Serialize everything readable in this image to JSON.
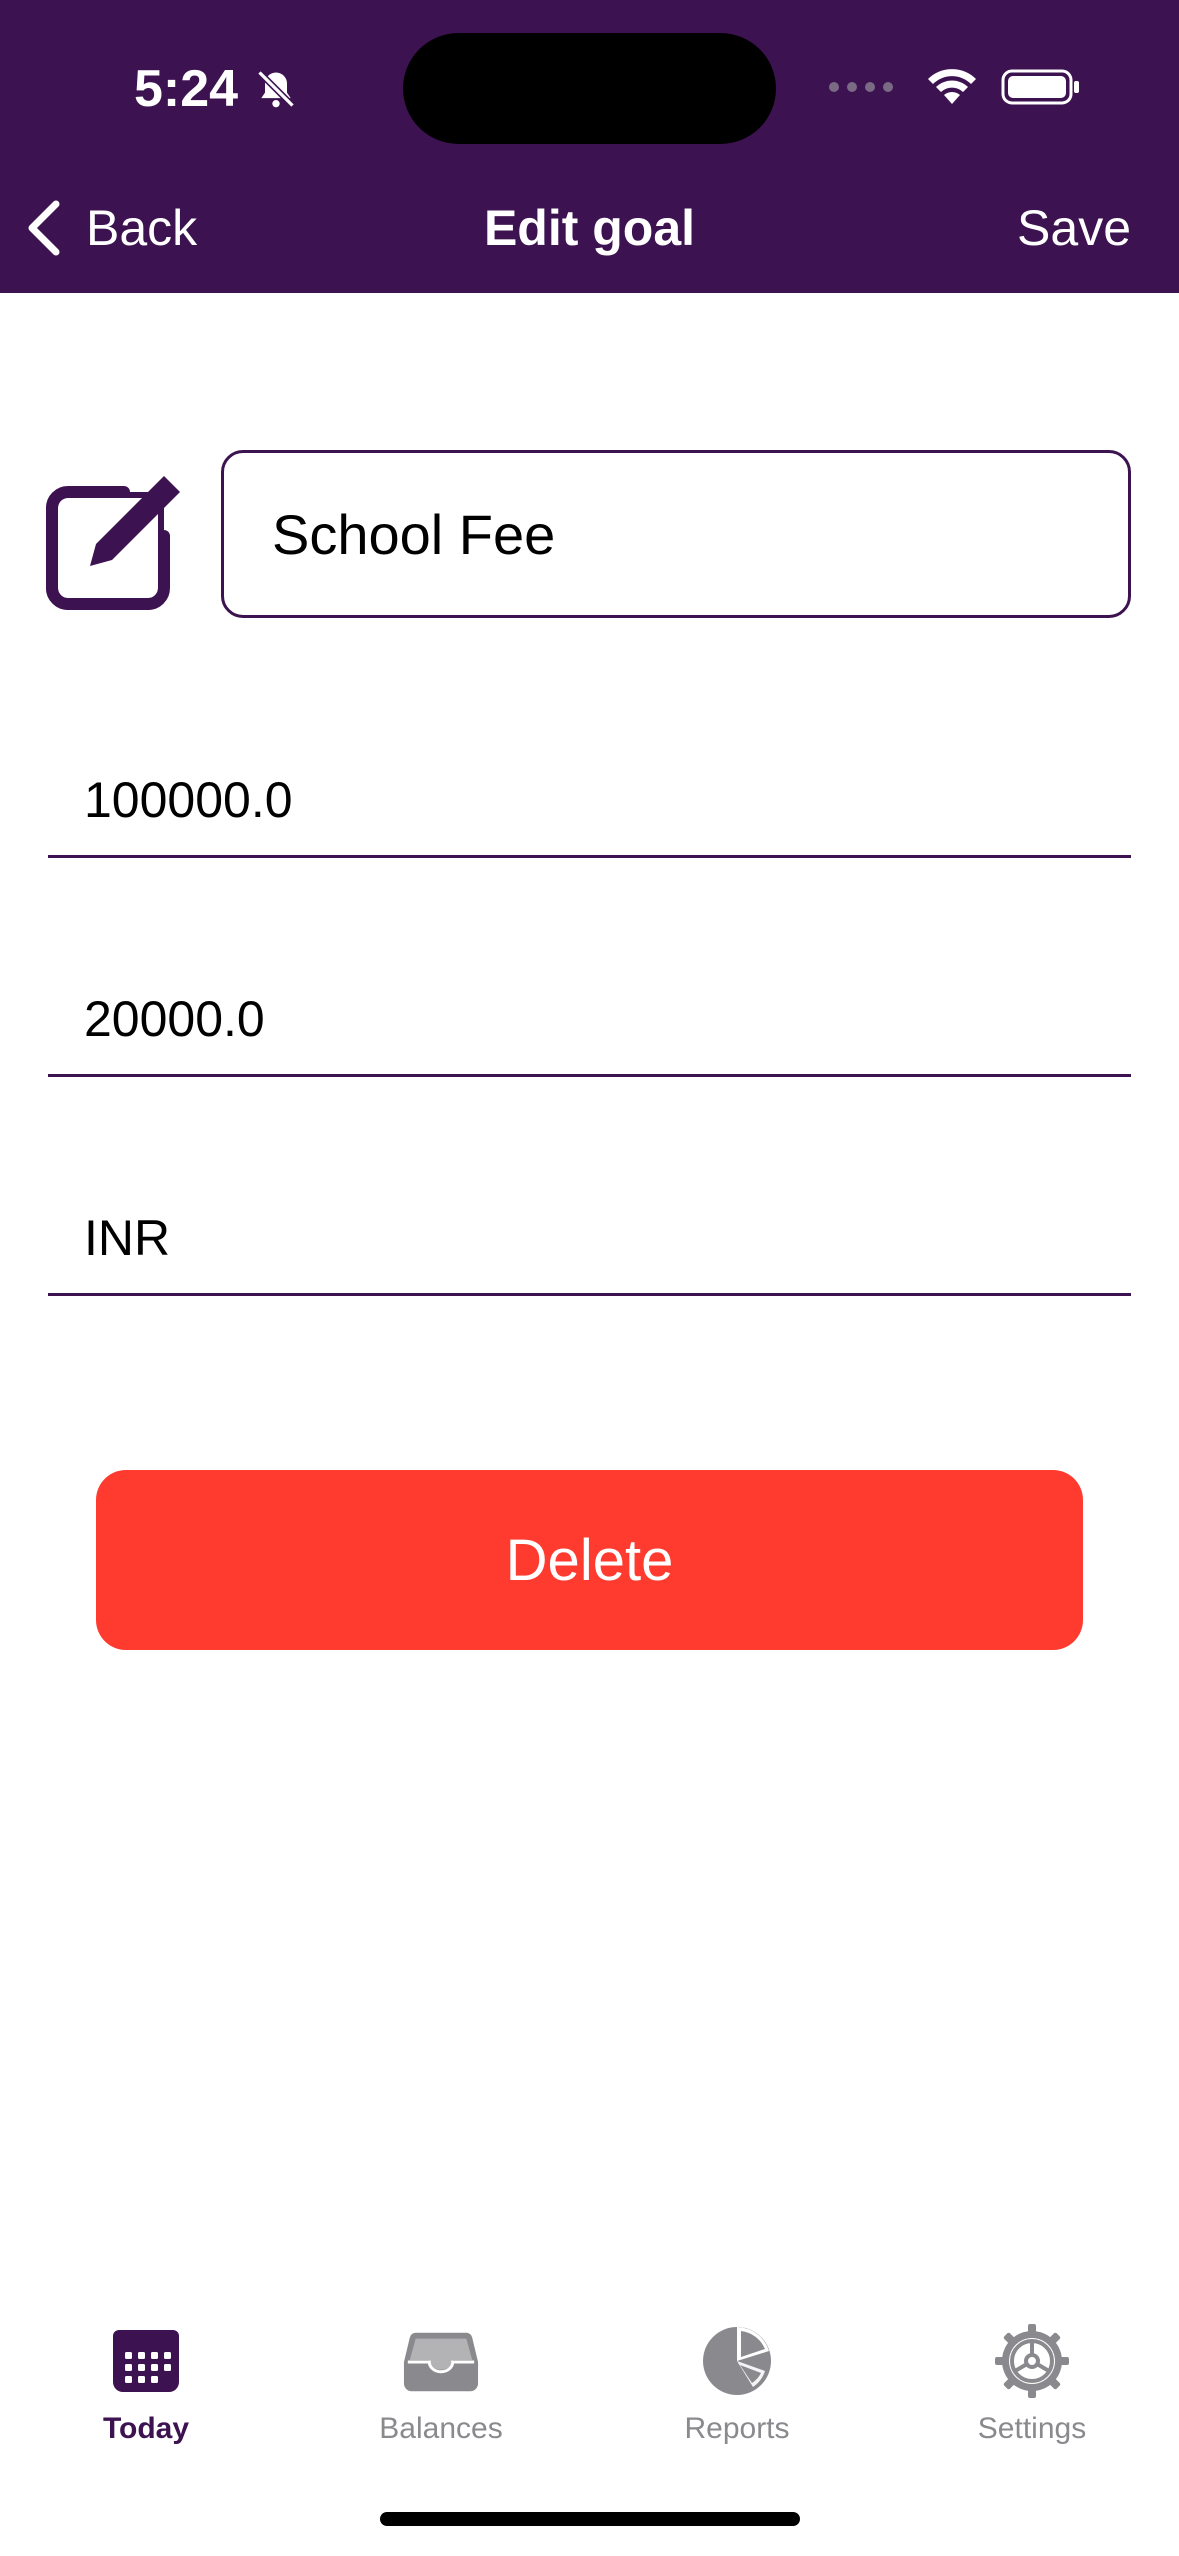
{
  "status_bar": {
    "time": "5:24",
    "icons": [
      "bell-slash-icon",
      "cellular-icon",
      "wifi-icon",
      "battery-icon"
    ]
  },
  "nav": {
    "back_label": "Back",
    "title": "Edit goal",
    "save_label": "Save"
  },
  "form": {
    "name_value": "School Fee",
    "target_amount_value": "100000.0",
    "saved_amount_value": "20000.0",
    "currency_value": "INR",
    "delete_label": "Delete"
  },
  "tabs": [
    {
      "label": "Today",
      "icon": "calendar-icon",
      "active": true
    },
    {
      "label": "Balances",
      "icon": "tray-icon",
      "active": false
    },
    {
      "label": "Reports",
      "icon": "pie-chart-icon",
      "active": false
    },
    {
      "label": "Settings",
      "icon": "gear-icon",
      "active": false
    }
  ],
  "colors": {
    "header_bg": "#3d1251",
    "accent": "#3d1251",
    "delete": "#ff3b30",
    "inactive_tab": "#8a8a8e"
  }
}
